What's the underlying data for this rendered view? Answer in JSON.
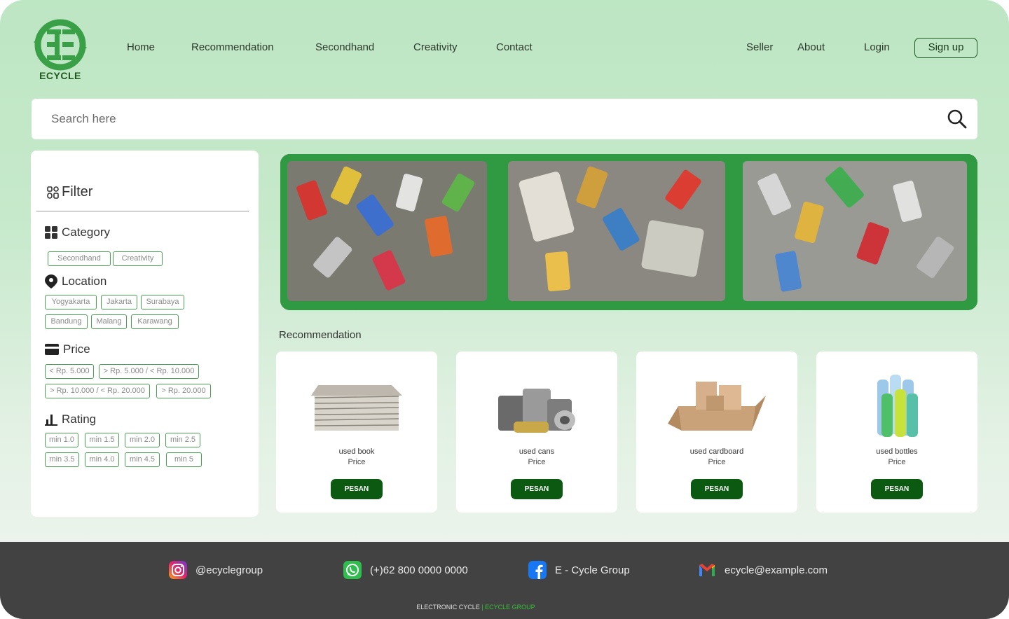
{
  "brand": {
    "name": "ECYCLE",
    "color": "#3aa048"
  },
  "nav": {
    "left": [
      "Home",
      "Recommendation",
      "Secondhand",
      "Creativity",
      "Contact"
    ],
    "right": [
      "Seller",
      "About",
      "Login"
    ],
    "signup": "Sign up"
  },
  "search": {
    "placeholder": "Search here"
  },
  "filter": {
    "title": "Filter",
    "category": {
      "label": "Category",
      "options": [
        "Secondhand",
        "Creativity"
      ]
    },
    "location": {
      "label": "Location",
      "options": [
        "Yogyakarta",
        "Jakarta",
        "Surabaya",
        "Bandung",
        "Malang",
        "Karawang"
      ]
    },
    "price": {
      "label": "Price",
      "options": [
        "< Rp. 5.000",
        "> Rp. 5.000 / < Rp. 10.000",
        "> Rp. 10.000 / < Rp. 20.000",
        "> Rp. 20.000"
      ]
    },
    "rating": {
      "label": "Rating",
      "options": [
        "min 1.0",
        "min 1.5",
        "min 2.0",
        "min 2.5",
        "min 3.5",
        "min 4.0",
        "min 4.5",
        "min 5"
      ]
    }
  },
  "recommendation": {
    "title": "Recommendation",
    "items": [
      {
        "name": "used book",
        "price": "Price",
        "button": "PESAN"
      },
      {
        "name": "used cans",
        "price": "Price",
        "button": "PESAN"
      },
      {
        "name": "used cardboard",
        "price": "Price",
        "button": "PESAN"
      },
      {
        "name": "used bottles",
        "price": "Price",
        "button": "PESAN"
      }
    ]
  },
  "footer": {
    "instagram": "@ecyclegroup",
    "whatsapp": "(+)62 800 0000 0000",
    "facebook": "E - Cycle Group",
    "email": "ecycle@example.com",
    "copyright_main": "ELECTRONIC CYCLE",
    "copyright_sep": " | ",
    "copyright_group": "ECYCLE GROUP"
  },
  "colors": {
    "accent": "#0c5a12",
    "header_bg": "#bde6c3",
    "footer_bg": "#424242",
    "chip_border": "#49a050"
  }
}
